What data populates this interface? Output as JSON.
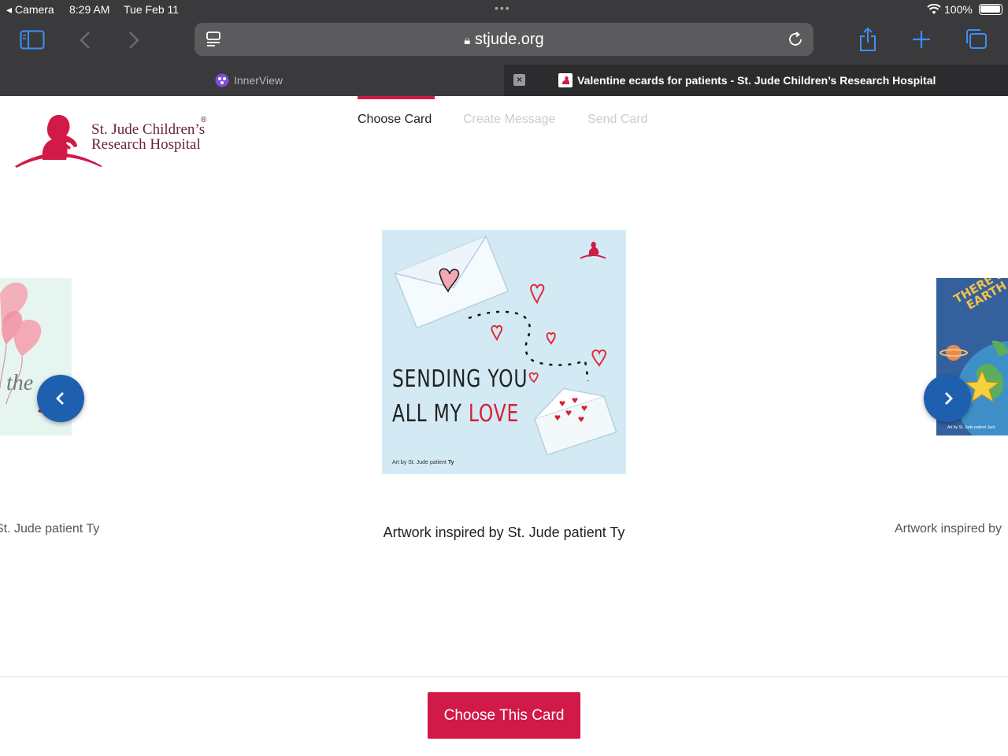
{
  "status_bar": {
    "back_app": "Camera",
    "time": "8:29 AM",
    "date": "Tue Feb 11",
    "battery": "100%"
  },
  "browser": {
    "url": "stjude.org",
    "tabs": [
      {
        "label": "InnerView"
      },
      {
        "label": "Valentine ecards for patients - St. Jude Children’s Research Hospital"
      }
    ]
  },
  "site": {
    "logo_line1": "St. Jude Children’s",
    "logo_line2": "Research Hospital",
    "registered": "®",
    "brand_color": "#d11a47"
  },
  "steps": [
    {
      "label": "Choose Card",
      "active": true
    },
    {
      "label": "Create Message",
      "active": false
    },
    {
      "label": "Send Card",
      "active": false
    }
  ],
  "carousel": {
    "left_card": {
      "text": "the",
      "caption": "St. Jude patient Ty"
    },
    "main_card": {
      "line1": "SENDING YOU",
      "line2_a": "ALL MY ",
      "line2_b": "LOVE",
      "credit_a": "Art by St. Jude patient ",
      "credit_b": "Ty",
      "caption": "Artwork inspired by St. Jude patient Ty"
    },
    "right_card": {
      "text1": "THERE'S",
      "text2": "EARTH",
      "credit": "Art by St. Jude patient  Jack",
      "caption": "Artwork inspired by"
    }
  },
  "actions": {
    "choose_button": "Choose This Card"
  }
}
